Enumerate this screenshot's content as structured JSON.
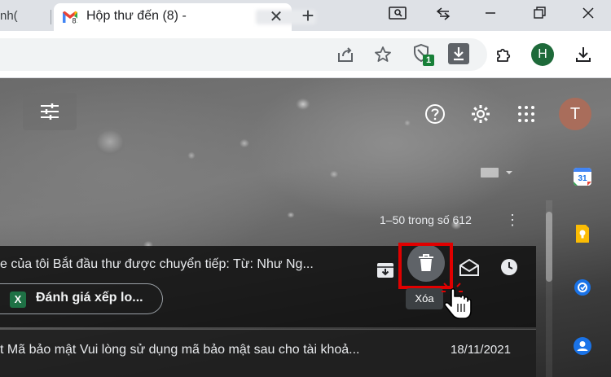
{
  "browser": {
    "prev_tab_text": "nh(",
    "active_tab": {
      "title": "Hộp thư đến (8) -"
    },
    "profile_initial": "H",
    "extension_badge": "1"
  },
  "gmail": {
    "profile_initial": "T",
    "pagination": "1–50 trong số 612",
    "rows": [
      {
        "text": "e của tôi Bắt đầu thư được chuyển tiếp: Từ: Như Ng...",
        "attachment_icon_letter": "X",
        "attachment_label": "Đánh giá xếp lo..."
      },
      {
        "text": "t Mã bảo mật Vui lòng sử dụng mã bảo mật sau cho tài khoả...",
        "date": "18/11/2021"
      }
    ],
    "tooltip": "Xóa"
  },
  "colors": {
    "highlight_border": "#e00000",
    "gmail_red": "#ea4335",
    "profile_h_bg": "#1e6a3a",
    "profile_t_bg": "#a96d5b"
  }
}
